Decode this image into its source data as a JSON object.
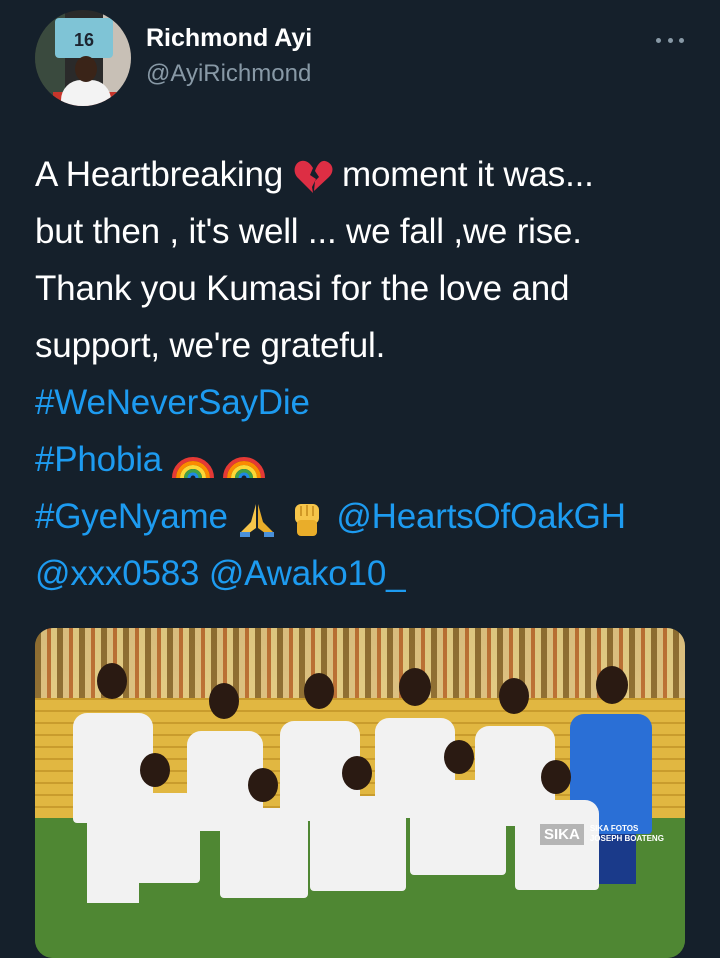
{
  "author": {
    "name": "Richmond Ayi",
    "handle": "@AyiRichmond",
    "avatar_jersey_number": "16"
  },
  "tweet": {
    "line1_before": "A Heartbreaking ",
    "line1_emoji": "broken-heart",
    "line1_after": " moment it was...",
    "line2": "but then , it's well ... we fall ,we rise.",
    "line3": "Thank you Kumasi for the love and",
    "line4": "support, we're grateful.",
    "hashtag1": "#WeNeverSayDie",
    "hashtag2": "#Phobia",
    "hashtag2_emojis": [
      "rainbow",
      "rainbow"
    ],
    "hashtag3": "#GyeNyame",
    "hashtag3_emojis": [
      "folded-hands",
      "raised-fist"
    ],
    "mention1": "@HeartsOfOakGH",
    "mention2": "@xxx0583",
    "mention3": "@Awako10_"
  },
  "photo": {
    "watermark_logo": "SIKA",
    "watermark_line1": "SIKA FOTOS",
    "watermark_line2": "JOSEPH BOATENG"
  },
  "colors": {
    "background": "#15202b",
    "link": "#1d9bf0",
    "secondary_text": "#8899a6"
  }
}
